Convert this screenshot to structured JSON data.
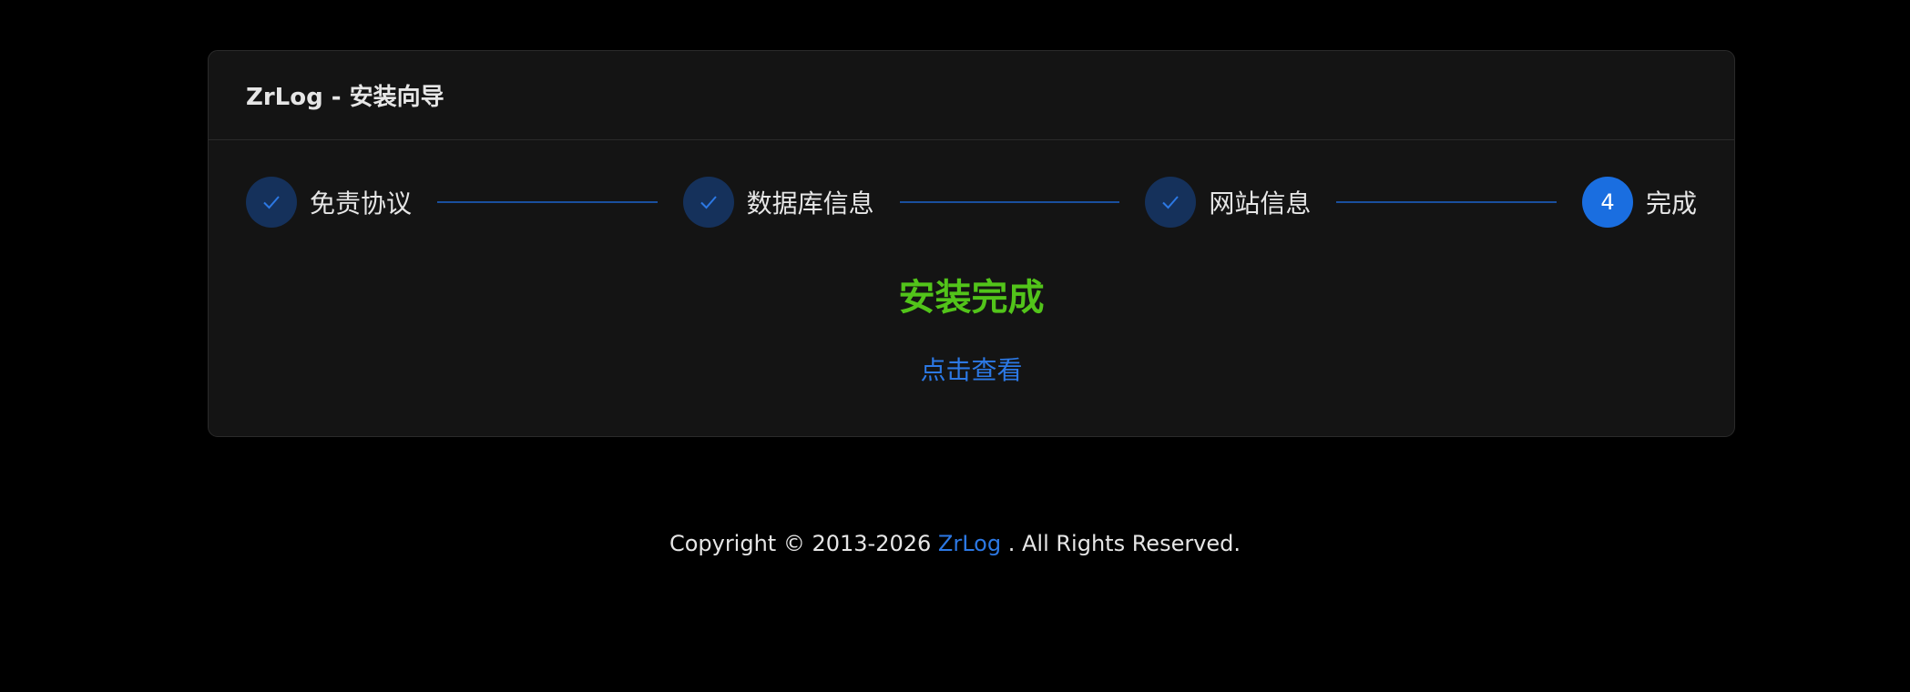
{
  "header": {
    "title": "ZrLog - 安装向导"
  },
  "steps": [
    {
      "label": "免责协议",
      "status": "done",
      "icon": "check-icon"
    },
    {
      "label": "数据库信息",
      "status": "done",
      "icon": "check-icon"
    },
    {
      "label": "网站信息",
      "status": "done",
      "icon": "check-icon"
    },
    {
      "label": "完成",
      "status": "active",
      "number": "4"
    }
  ],
  "result": {
    "title": "安装完成",
    "link_label": "点击查看"
  },
  "footer": {
    "prefix": "Copyright © 2013-2026 ",
    "brand": "ZrLog",
    "suffix": " . All Rights Reserved."
  },
  "colors": {
    "background": "#000000",
    "card": "#141414",
    "accent": "#1a6ee0",
    "success": "#52c41a",
    "link": "#2c78e4"
  }
}
